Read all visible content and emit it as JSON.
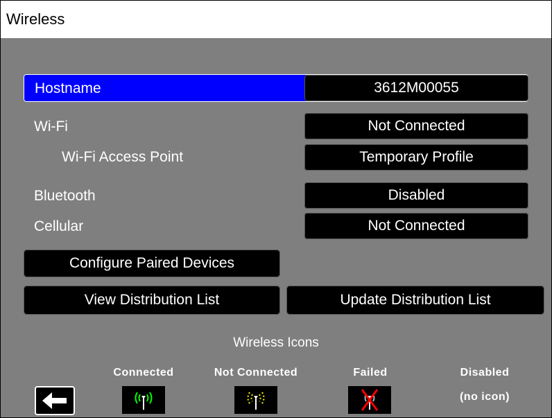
{
  "window": {
    "title": "Wireless"
  },
  "settings": {
    "hostname": {
      "label": "Hostname",
      "value": "3612M00055"
    },
    "wifi": {
      "label": "Wi-Fi",
      "value": "Not Connected"
    },
    "wifi_ap": {
      "label": "Wi-Fi Access Point",
      "value": "Temporary Profile"
    },
    "bluetooth": {
      "label": "Bluetooth",
      "value": "Disabled"
    },
    "cellular": {
      "label": "Cellular",
      "value": "Not Connected"
    }
  },
  "buttons": {
    "configure_paired": "Configure Paired Devices",
    "view_distribution": "View Distribution List",
    "update_distribution": "Update Distribution List"
  },
  "legend": {
    "title": "Wireless Icons",
    "connected": "Connected",
    "not_connected": "Not Connected",
    "failed": "Failed",
    "disabled": "Disabled",
    "disabled_note": "(no icon)"
  },
  "colors": {
    "background": "#7f7f7f",
    "highlight": "#0000ff",
    "connected_icon": "#00ff00",
    "not_connected_icon": "#ffff00",
    "failed_icon": "#ff0000"
  },
  "icons": {
    "back": "left-arrow-icon",
    "connected": "wireless-connected-icon",
    "not_connected": "wireless-not-connected-icon",
    "failed": "wireless-failed-icon"
  }
}
